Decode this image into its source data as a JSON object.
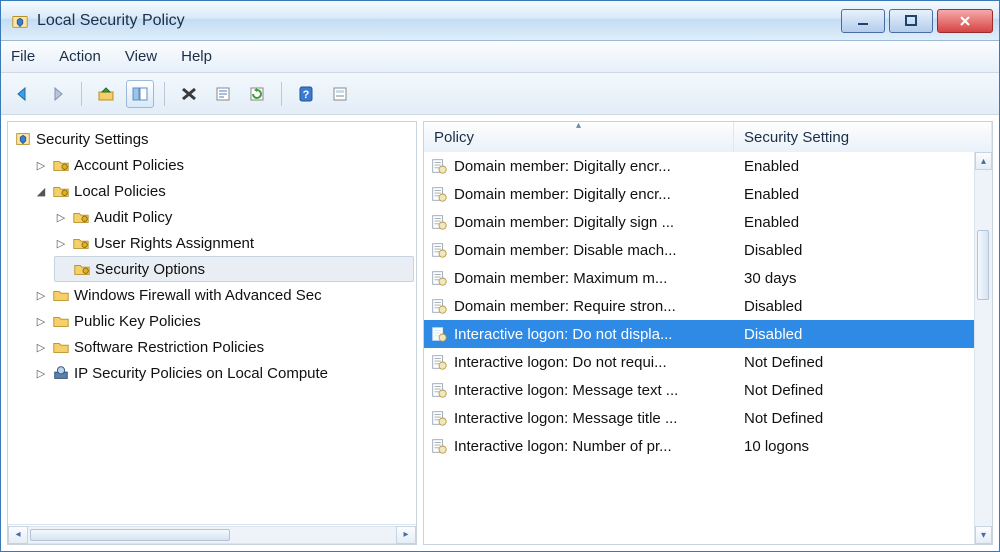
{
  "window": {
    "title": "Local Security Policy"
  },
  "menu": {
    "file": "File",
    "action": "Action",
    "view": "View",
    "help": "Help"
  },
  "tree": {
    "root": "Security Settings",
    "account_policies": "Account Policies",
    "local_policies": "Local Policies",
    "audit_policy": "Audit Policy",
    "user_rights": "User Rights Assignment",
    "security_options": "Security Options",
    "firewall": "Windows Firewall with Advanced Sec",
    "public_key": "Public Key Policies",
    "software_restriction": "Software Restriction Policies",
    "ipsec": "IP Security Policies on Local Compute"
  },
  "columns": {
    "policy": "Policy",
    "setting": "Security Setting"
  },
  "rows": [
    {
      "name": "Domain member: Digitally encr...",
      "setting": "Enabled"
    },
    {
      "name": "Domain member: Digitally encr...",
      "setting": "Enabled"
    },
    {
      "name": "Domain member: Digitally sign ...",
      "setting": "Enabled"
    },
    {
      "name": "Domain member: Disable mach...",
      "setting": "Disabled"
    },
    {
      "name": "Domain member: Maximum m...",
      "setting": "30 days"
    },
    {
      "name": "Domain member: Require stron...",
      "setting": "Disabled"
    },
    {
      "name": "Interactive logon: Do not displa...",
      "setting": "Disabled",
      "selected": true
    },
    {
      "name": "Interactive logon: Do not requi...",
      "setting": "Not Defined"
    },
    {
      "name": "Interactive logon: Message text ...",
      "setting": "Not Defined"
    },
    {
      "name": "Interactive logon: Message title ...",
      "setting": "Not Defined"
    },
    {
      "name": "Interactive logon: Number of pr...",
      "setting": "10 logons"
    }
  ]
}
